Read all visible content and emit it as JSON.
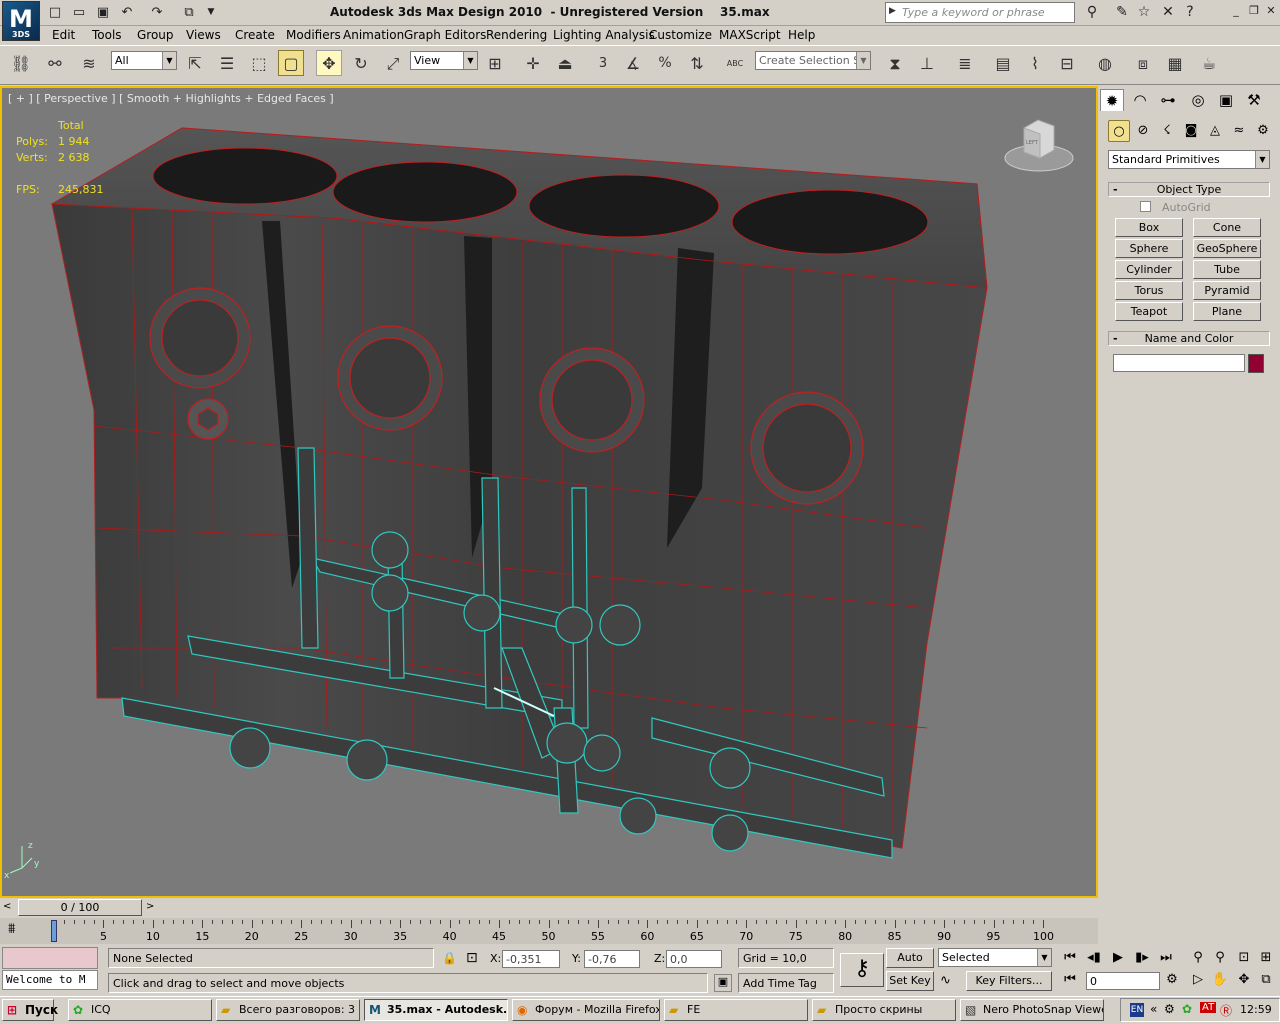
{
  "app": {
    "title": "Autodesk 3ds Max Design 2010  - Unregistered Version    35.max",
    "logo_text": "M",
    "logo_sub": "3DS",
    "search_placeholder": "Type a keyword or phrase"
  },
  "quick_access": {
    "icons": [
      "new-file-icon",
      "open-file-icon",
      "save-icon",
      "undo-icon",
      "redo-icon",
      "hold-icon",
      "dropdown-icon"
    ]
  },
  "menu": [
    "Edit",
    "Tools",
    "Group",
    "Views",
    "Create",
    "Modifiers",
    "Animation",
    "Graph Editors",
    "Rendering",
    "Lighting Analysis",
    "Customize",
    "MAXScript",
    "Help"
  ],
  "toolbar": {
    "selection_filter": "All",
    "reference_coord": "View",
    "named_selection_placeholder": "Create Selection Se",
    "snaps_label": "3",
    "percent_label": "%",
    "abc_label": "ABC"
  },
  "viewport": {
    "label": "[ + ] [ Perspective ] [ Smooth + Highlights + Edged Faces ]",
    "stats_header": "Total",
    "stats": [
      {
        "label": "Polys:",
        "value": "1 944"
      },
      {
        "label": "Verts:",
        "value": "2 638"
      }
    ],
    "fps_label": "FPS:",
    "fps_value": "245,831",
    "viewcube_label": "LEFT",
    "colors": {
      "background": "#7a7a7a",
      "edge_red": "#c02020",
      "edge_cyan": "#30c8c0",
      "border": "#f0c000"
    }
  },
  "command_panel": {
    "tabs": [
      "create-tab-icon",
      "modify-tab-icon",
      "hierarchy-tab-icon",
      "motion-tab-icon",
      "display-tab-icon",
      "utilities-tab-icon"
    ],
    "subtabs": [
      "geometry-icon",
      "shapes-icon",
      "lights-icon",
      "cameras-icon",
      "helpers-icon",
      "spacewarps-icon",
      "systems-icon"
    ],
    "category": "Standard Primitives",
    "object_type_title": "Object Type",
    "autogrid_label": "AutoGrid",
    "object_buttons": [
      "Box",
      "Cone",
      "Sphere",
      "GeoSphere",
      "Cylinder",
      "Tube",
      "Torus",
      "Pyramid",
      "Teapot",
      "Plane"
    ],
    "name_color_title": "Name and Color",
    "name_value": "",
    "object_color": "#900030"
  },
  "timeline": {
    "slider_label": "0 / 100",
    "ticks": [
      "0",
      "5",
      "10",
      "15",
      "20",
      "25",
      "30",
      "35",
      "40",
      "45",
      "50",
      "55",
      "60",
      "65",
      "70",
      "75",
      "80",
      "85",
      "90",
      "95",
      "100"
    ]
  },
  "status": {
    "maxscript_listener": "Welcome to M",
    "selection_status": "None Selected",
    "prompt": "Click and drag to select and move objects",
    "x_label": "X:",
    "x_value": "-0,351",
    "y_label": "Y:",
    "y_value": "-0,76",
    "z_label": "Z:",
    "z_value": "0,0",
    "grid": "Grid = 10,0",
    "add_time_tag": "Add Time Tag",
    "auto_key": "Auto Key",
    "set_key": "Set Key",
    "key_mode": "Selected",
    "key_filters": "Key Filters...",
    "frame_value": "0"
  },
  "taskbar": {
    "start": "Пуск",
    "tasks": [
      {
        "label": "ICQ",
        "icon": "icq-icon"
      },
      {
        "label": "Всего разговоров: 3 ...",
        "icon": "folder-icon"
      },
      {
        "label": "35.max - Autodesk...",
        "icon": "3dsmax-icon",
        "active": true
      },
      {
        "label": "Форум - Mozilla Firefox",
        "icon": "firefox-icon"
      },
      {
        "label": "FE",
        "icon": "folder-icon"
      },
      {
        "label": "Просто скрины",
        "icon": "folder-icon"
      },
      {
        "label": "Nero PhotoSnap Viewer",
        "icon": "nero-icon"
      }
    ],
    "lang": "EN",
    "clock": "12:59"
  }
}
